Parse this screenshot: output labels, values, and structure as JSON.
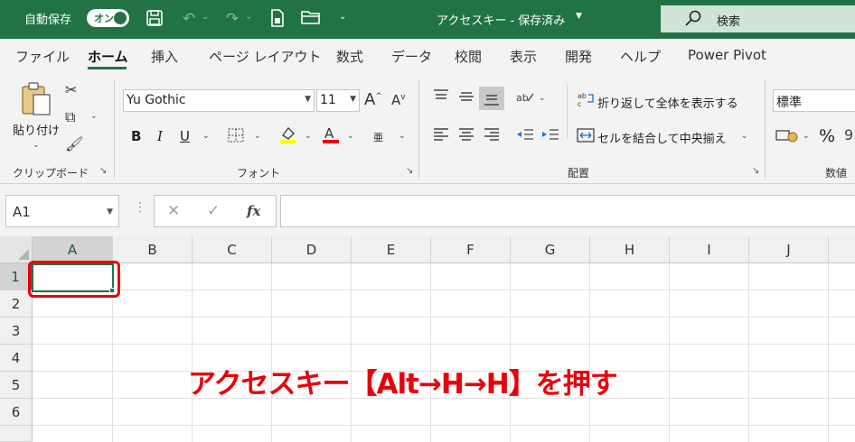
{
  "titlebar": {
    "autosave_label": "自動保存",
    "toggle_label": "オン",
    "title": "アクセスキー - 保存済み",
    "search_label": "検索"
  },
  "menu": {
    "tabs": [
      "ファイル",
      "ホーム",
      "挿入",
      "ページ レイアウト",
      "数式",
      "データ",
      "校閲",
      "表示",
      "開発",
      "ヘルプ",
      "Power Pivot"
    ],
    "active_tab": "ホーム"
  },
  "ribbon": {
    "clipboard": {
      "paste_label": "貼り付け",
      "group_label": "クリップボード"
    },
    "font": {
      "font_name": "Yu Gothic",
      "font_size": "11",
      "group_label": "フォント",
      "bold": "B",
      "italic": "I",
      "underline": "U",
      "phonetic": "亜"
    },
    "alignment": {
      "wrap_text": "折り返して全体を表示する",
      "merge_center": "セルを結合して中央揃え",
      "group_label": "配置"
    },
    "number": {
      "format": "標準",
      "percent": "%",
      "group_label": "数値"
    }
  },
  "formula_bar": {
    "name_box": "A1",
    "fx": "fx",
    "content": ""
  },
  "grid": {
    "columns": [
      "A",
      "B",
      "C",
      "D",
      "E",
      "F",
      "G",
      "H",
      "I",
      "J"
    ],
    "rows": [
      "1",
      "2",
      "3",
      "4",
      "5",
      "6"
    ],
    "selected_cell": "A1"
  },
  "annotation": {
    "text": "アクセスキー【Alt→H→H】を押す"
  },
  "colors": {
    "accent": "#217346",
    "highlight_red": "#e8000b"
  }
}
